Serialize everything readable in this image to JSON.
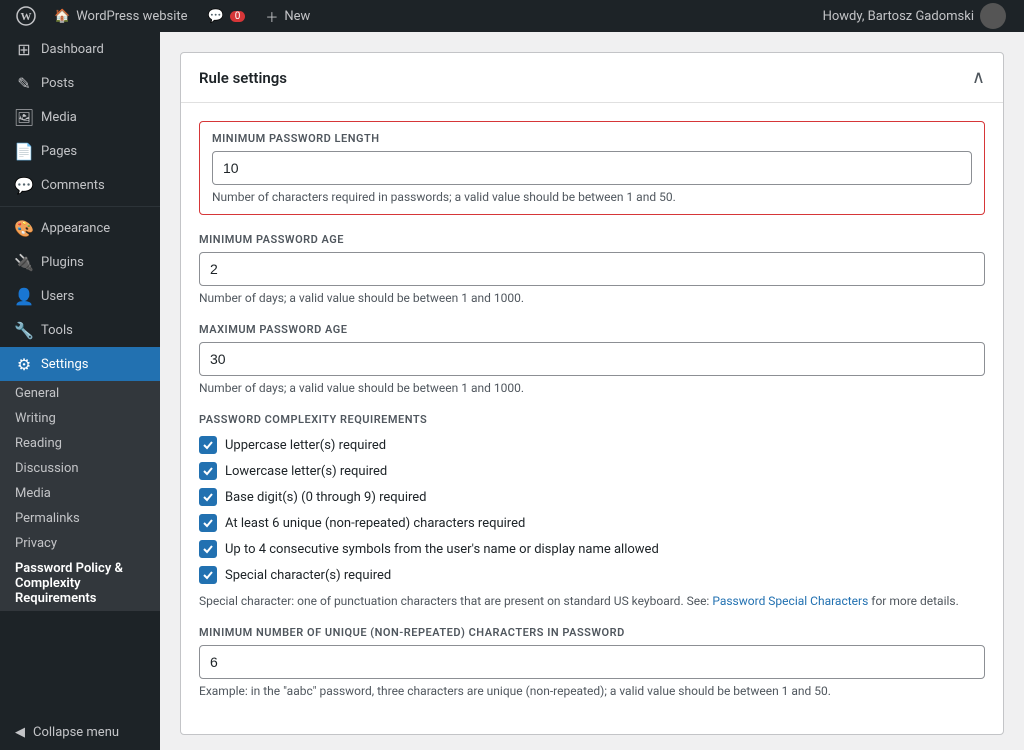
{
  "adminbar": {
    "logo_label": "WordPress",
    "site_name": "WordPress website",
    "comments_label": "0",
    "new_label": "New",
    "howdy": "Howdy, Bartosz Gadomski"
  },
  "sidebar": {
    "items": [
      {
        "id": "dashboard",
        "label": "Dashboard",
        "icon": "⊞"
      },
      {
        "id": "posts",
        "label": "Posts",
        "icon": "✎"
      },
      {
        "id": "media",
        "label": "Media",
        "icon": "⊞"
      },
      {
        "id": "pages",
        "label": "Pages",
        "icon": "⊞"
      },
      {
        "id": "comments",
        "label": "Comments",
        "icon": "💬"
      },
      {
        "id": "appearance",
        "label": "Appearance",
        "icon": "🎨"
      },
      {
        "id": "plugins",
        "label": "Plugins",
        "icon": "🔌"
      },
      {
        "id": "users",
        "label": "Users",
        "icon": "👤"
      },
      {
        "id": "tools",
        "label": "Tools",
        "icon": "🔧"
      },
      {
        "id": "settings",
        "label": "Settings",
        "icon": "⚙"
      }
    ],
    "submenu": [
      {
        "id": "general",
        "label": "General"
      },
      {
        "id": "writing",
        "label": "Writing"
      },
      {
        "id": "reading",
        "label": "Reading"
      },
      {
        "id": "discussion",
        "label": "Discussion"
      },
      {
        "id": "media",
        "label": "Media"
      },
      {
        "id": "permalinks",
        "label": "Permalinks"
      },
      {
        "id": "privacy",
        "label": "Privacy"
      },
      {
        "id": "password-policy",
        "label": "Password Policy & Complexity Requirements"
      }
    ],
    "collapse_label": "Collapse menu"
  },
  "card": {
    "title": "Rule settings",
    "chevron": "∧"
  },
  "fields": {
    "min_password_length": {
      "label": "MINIMUM PASSWORD LENGTH",
      "value": "10",
      "hint": "Number of characters required in passwords; a valid value should be between 1 and 50."
    },
    "min_password_age": {
      "label": "MINIMUM PASSWORD AGE",
      "value": "2",
      "hint": "Number of days; a valid value should be between 1 and 1000."
    },
    "max_password_age": {
      "label": "MAXIMUM PASSWORD AGE",
      "value": "30",
      "hint": "Number of days; a valid value should be between 1 and 1000."
    },
    "complexity": {
      "label": "PASSWORD COMPLEXITY REQUIREMENTS",
      "checkboxes": [
        {
          "id": "uppercase",
          "label": "Uppercase letter(s) required",
          "checked": true
        },
        {
          "id": "lowercase",
          "label": "Lowercase letter(s) required",
          "checked": true
        },
        {
          "id": "digits",
          "label": "Base digit(s) (0 through 9) required",
          "checked": true
        },
        {
          "id": "unique",
          "label": "At least 6 unique (non-repeated) characters required",
          "checked": true
        },
        {
          "id": "consecutive",
          "label": "Up to 4 consecutive symbols from the user's name or display name allowed",
          "checked": true
        },
        {
          "id": "special",
          "label": "Special character(s) required",
          "checked": true
        }
      ],
      "special_note": "Special character: one of punctuation characters that are present on standard US keyboard. See: ",
      "special_link_text": "Password Special Characters",
      "special_note_end": " for more details."
    },
    "min_unique_chars": {
      "label": "MINIMUM NUMBER OF UNIQUE (NON-REPEATED) CHARACTERS IN PASSWORD",
      "value": "6",
      "hint": "Example: in the \"aabc\" password, three characters are unique (non-repeated); a valid value should be between 1 and 50."
    }
  }
}
